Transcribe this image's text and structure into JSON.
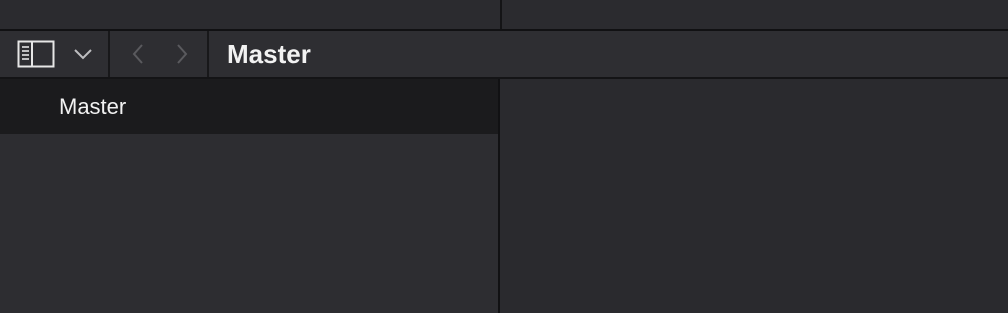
{
  "colors": {
    "background": "#2a2a2e",
    "toolbar": "#2e2e32",
    "selected_row": "#1b1b1d",
    "text": "#f2f2f2",
    "icon_active": "#e6e6e6",
    "icon_disabled": "#5a5a5e"
  },
  "toolbar": {
    "sidebar_toggle_icon": "sidebar-toggle-icon",
    "dropdown_icon": "chevron-down-icon",
    "back_icon": "chevron-left-icon",
    "forward_icon": "chevron-right-icon",
    "title": "Master"
  },
  "sidebar": {
    "items": [
      {
        "label": "Master",
        "selected": true
      }
    ]
  }
}
